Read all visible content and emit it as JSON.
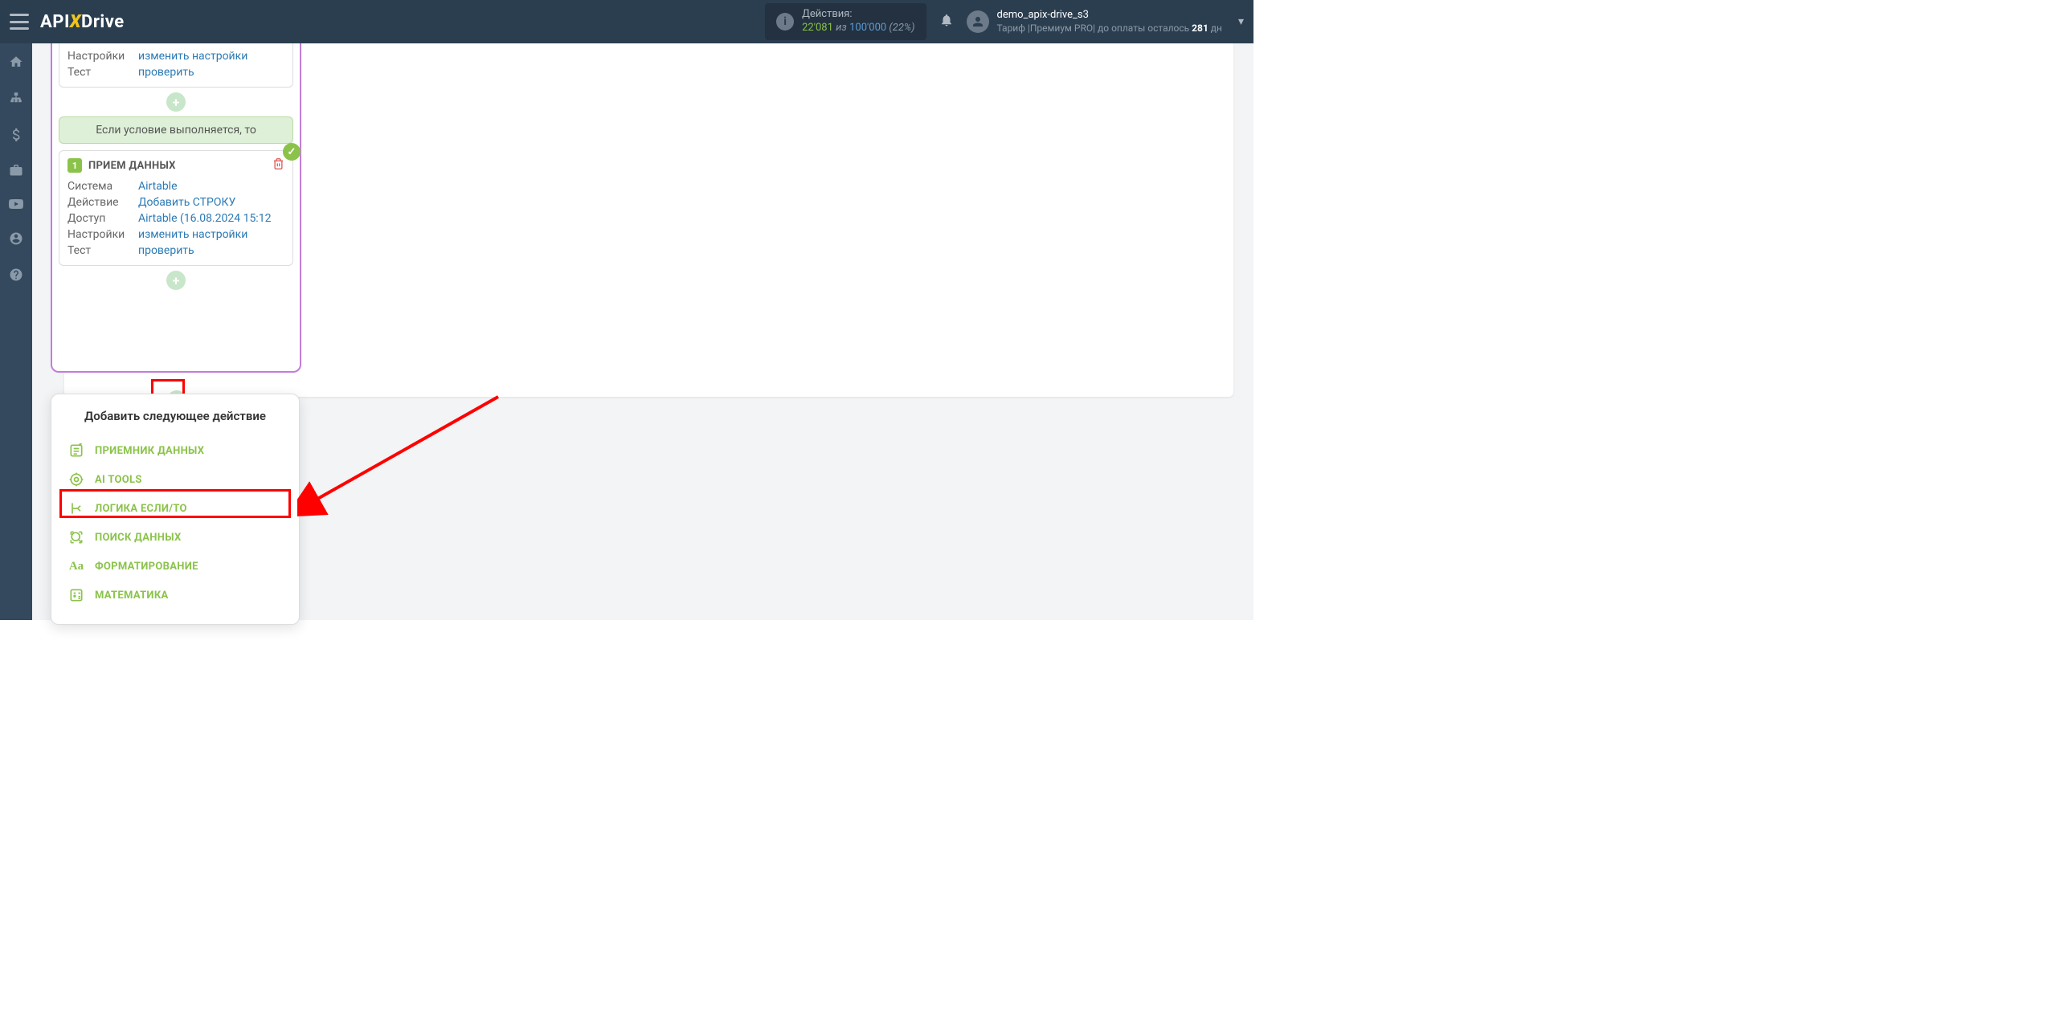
{
  "header": {
    "logo": {
      "api": "API",
      "x": "X",
      "drive": "Drive"
    },
    "actions": {
      "label": "Действия:",
      "current": "22'081",
      "of": "из",
      "total": "100'000",
      "pct": "(22%)"
    },
    "user": {
      "name": "demo_apix-drive_s3",
      "tariff_prefix": "Тариф |Премиум PRO| до оплаты осталось ",
      "days": "281",
      "days_suffix": " дн"
    }
  },
  "block_top": {
    "rows": {
      "settings_label": "Настройки",
      "settings_link": "изменить настройки",
      "test_label": "Тест",
      "test_link": "проверить"
    }
  },
  "condition": "Если условие выполняется, то",
  "block_data": {
    "num": "1",
    "title": "ПРИЕМ ДАННЫХ",
    "rows": {
      "system_label": "Система",
      "system_link": "Airtable",
      "action_label": "Действие",
      "action_link": "Добавить СТРОКУ",
      "access_label": "Доступ",
      "access_link": "Airtable (16.08.2024 15:12",
      "settings_label": "Настройки",
      "settings_link": "изменить настройки",
      "test_label": "Тест",
      "test_link": "проверить"
    }
  },
  "popup": {
    "title": "Добавить следующее действие",
    "items": [
      {
        "label": "ПРИЕМНИК ДАННЫХ"
      },
      {
        "label": "AI TOOLS"
      },
      {
        "label": "ЛОГИКА ЕСЛИ/ТО"
      },
      {
        "label": "ПОИСК ДАННЫХ"
      },
      {
        "label": "ФОРМАТИРОВАНИЕ"
      },
      {
        "label": "МАТЕМАТИКА"
      }
    ]
  }
}
